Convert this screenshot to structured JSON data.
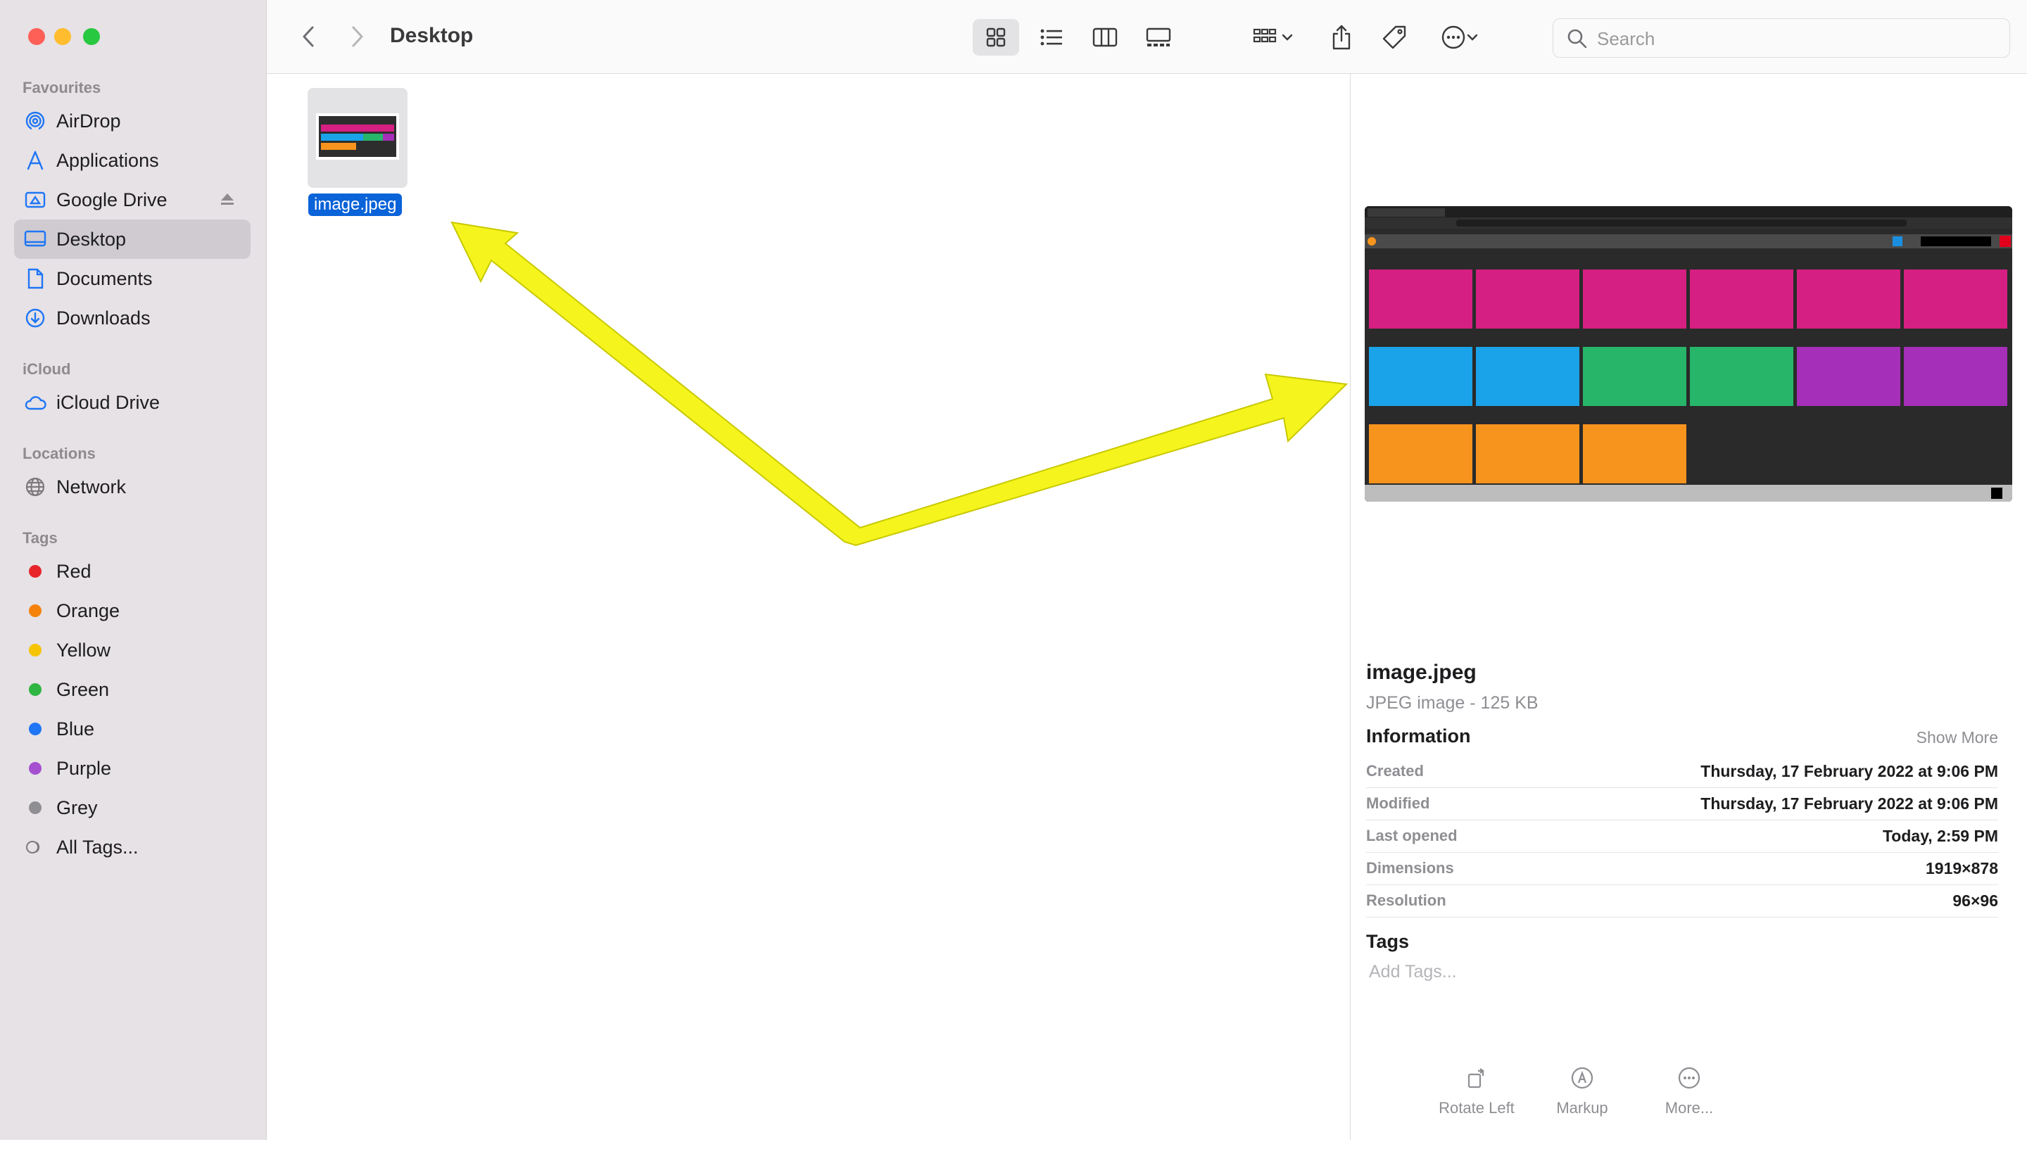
{
  "sidebar": {
    "sections": {
      "favourites": "Favourites",
      "icloud": "iCloud",
      "locations": "Locations",
      "tags": "Tags"
    },
    "favourites": [
      "AirDrop",
      "Applications",
      "Google Drive",
      "Desktop",
      "Documents",
      "Downloads"
    ],
    "icloud": [
      "iCloud Drive"
    ],
    "locations": [
      "Network"
    ],
    "tags": [
      {
        "label": "Red",
        "color": "#e8252a"
      },
      {
        "label": "Orange",
        "color": "#f5820b"
      },
      {
        "label": "Yellow",
        "color": "#f6c400"
      },
      {
        "label": "Green",
        "color": "#2fb541"
      },
      {
        "label": "Blue",
        "color": "#1f76f5"
      },
      {
        "label": "Purple",
        "color": "#a550d0"
      },
      {
        "label": "Grey",
        "color": "#8e8e93"
      }
    ],
    "all_tags": "All Tags..."
  },
  "toolbar": {
    "title": "Desktop",
    "search_placeholder": "Search"
  },
  "content": {
    "file_name": "image.jpeg"
  },
  "preview": {
    "name": "image.jpeg",
    "kind": "JPEG image - 125 KB",
    "information": "Information",
    "show_more": "Show More",
    "rows": [
      {
        "k": "Created",
        "v": "Thursday, 17 February 2022 at 9:06 PM"
      },
      {
        "k": "Modified",
        "v": "Thursday, 17 February 2022 at 9:06 PM"
      },
      {
        "k": "Last opened",
        "v": "Today, 2:59 PM"
      },
      {
        "k": "Dimensions",
        "v": "1919×878"
      },
      {
        "k": "Resolution",
        "v": "96×96"
      }
    ],
    "tags_heading": "Tags",
    "add_tags": "Add Tags...",
    "actions": [
      "Rotate Left",
      "Markup",
      "More..."
    ]
  },
  "colors": {
    "selection": "#0a63d8",
    "annotation_arrow": "#f5f51d"
  }
}
